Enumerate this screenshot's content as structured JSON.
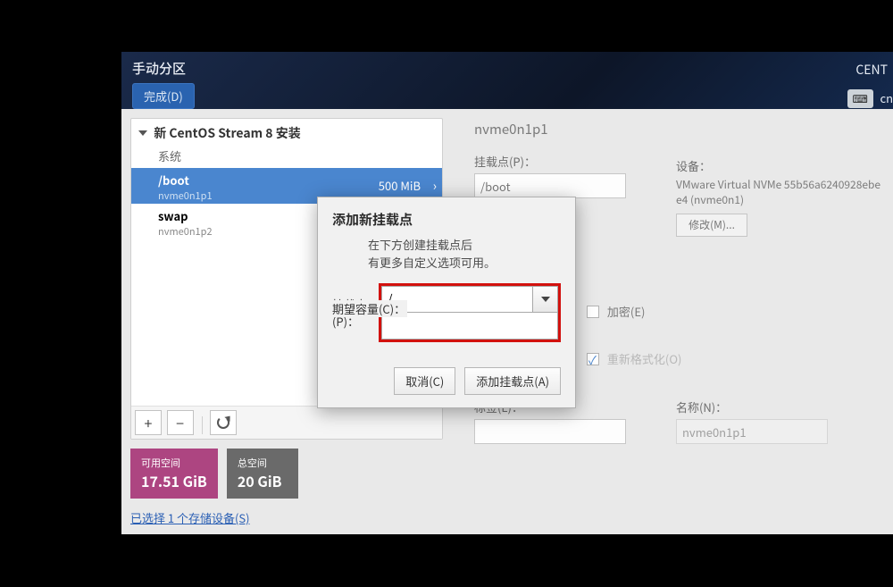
{
  "header": {
    "title": "手动分区",
    "done_btn": "完成(D)",
    "right_label": "CENT",
    "kbd_text": "cn"
  },
  "left_panel": {
    "title": "新 CentOS Stream 8 安装",
    "section": "系统",
    "items": [
      {
        "mount": "/boot",
        "device": "nvme0n1p1",
        "size": "500 MiB",
        "selected": true
      },
      {
        "mount": "swap",
        "device": "nvme0n1p2",
        "size": "",
        "selected": false
      }
    ],
    "add_glyph": "+",
    "remove_glyph": "−"
  },
  "sizes": {
    "avail_label": "可用空间",
    "avail_value": "17.51 GiB",
    "total_label": "总空间",
    "total_value": "20 GiB"
  },
  "storage_link": "已选择 1 个存储设备(S)",
  "right": {
    "current_device": "nvme0n1p1",
    "mount_label": "挂载点(P)：",
    "mount_value": "/boot",
    "devices_label": "设备：",
    "devices_value": "VMware Virtual NVMe 55b56a6240928ebe e4 (nvme0n1)",
    "modify_btn": "修改(M)...",
    "encrypt": "加密(E)",
    "reformat": "重新格式化(O)",
    "label_label": "标签(L)：",
    "label_value": "",
    "name_label": "名称(N)：",
    "name_value": "nvme0n1p1"
  },
  "modal": {
    "title": "添加新挂载点",
    "desc_line1": "在下方创建挂载点后",
    "desc_line2": "有更多自定义选项可用。",
    "mount_label": "挂载点(P)：",
    "mount_value": "/",
    "capacity_label": "期望容量(C)：",
    "capacity_value": "",
    "cancel_btn": "取消(C)",
    "add_btn": "添加挂载点(A)"
  }
}
